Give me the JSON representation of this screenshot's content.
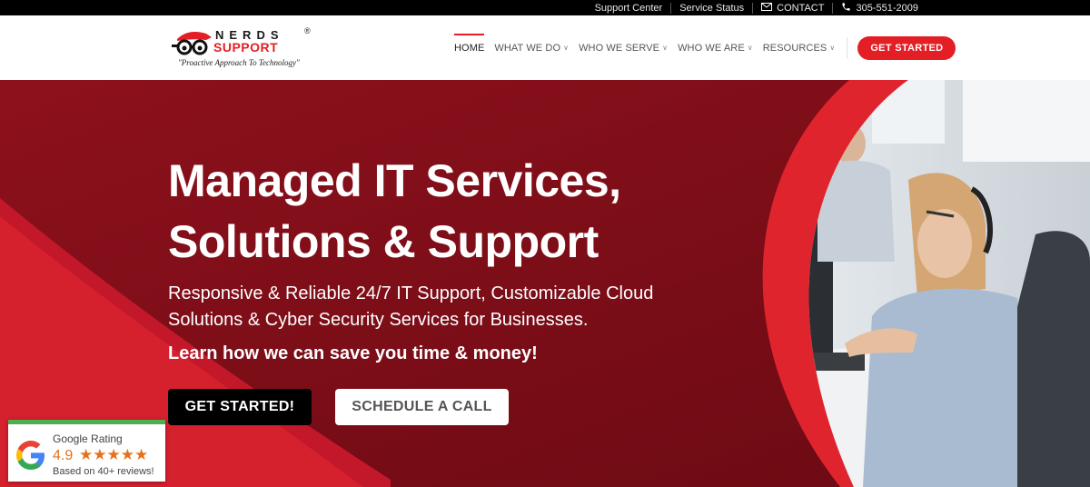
{
  "topbar": {
    "support_center": "Support Center",
    "service_status": "Service Status",
    "contact": "CONTACT",
    "phone": "305-551-2009"
  },
  "logo": {
    "brand_line1": "NERDS",
    "brand_line2": "SUPPORT",
    "registered": "®",
    "tagline": "\"Proactive Approach To Technology\""
  },
  "nav": {
    "items": [
      {
        "label": "HOME",
        "active": true
      },
      {
        "label": "WHAT WE DO",
        "dropdown": true
      },
      {
        "label": "WHO WE SERVE",
        "dropdown": true
      },
      {
        "label": "WHO WE ARE",
        "dropdown": true
      },
      {
        "label": "RESOURCES",
        "dropdown": true
      }
    ],
    "cta": "GET STARTED"
  },
  "hero": {
    "title_line1": "Managed IT Services,",
    "title_line2": "Solutions & Support",
    "subtitle": "Responsive & Reliable 24/7 IT Support, Customizable Cloud Solutions & Cyber Security Services for Businesses.",
    "cta_text": "Learn how we can save you time & money!",
    "primary_button": "GET STARTED!",
    "secondary_button": "SCHEDULE A CALL"
  },
  "rating": {
    "title": "Google Rating",
    "score": "4.9",
    "stars": "★★★★★",
    "reviews": "Based on 40+ reviews!"
  },
  "colors": {
    "brand_red": "#e31e24",
    "hero_dark": "#7e0e18",
    "star_orange": "#e7711b",
    "badge_green": "#4caf50"
  }
}
